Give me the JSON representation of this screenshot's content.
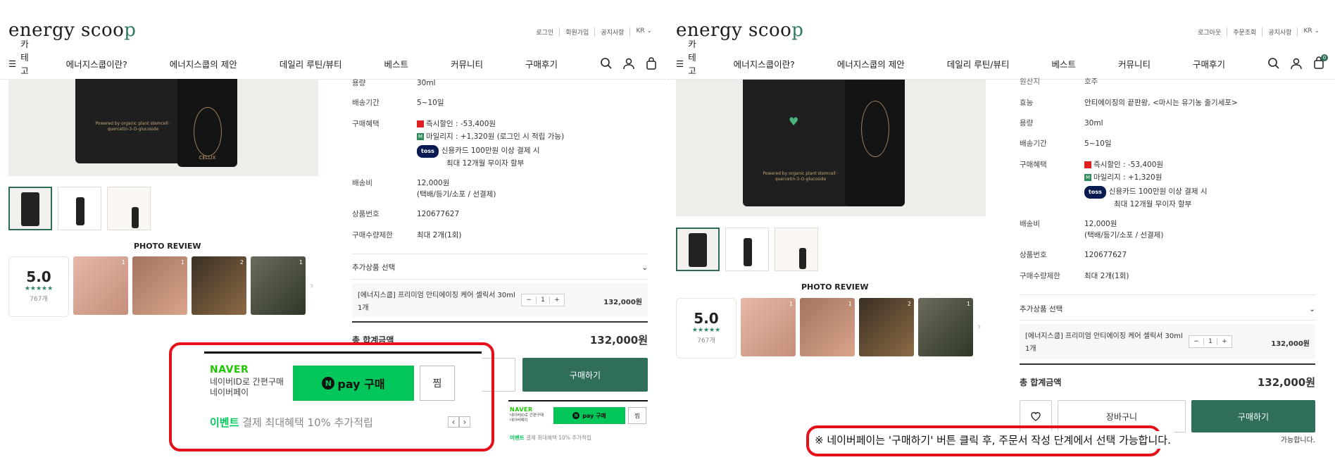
{
  "header": {
    "logo": "energy scoo",
    "logo_tail": "p",
    "left_util": [
      "로그인",
      "회원가입",
      "공지사항",
      "KR"
    ],
    "right_util": [
      "로그아웃",
      "주문조회",
      "공지사항",
      "KR"
    ],
    "category_label": "카테고리",
    "nav_items": [
      "에너지스쿱이란?",
      "에너지스쿱의 제안",
      "데일리 루틴/뷰티",
      "베스트",
      "커뮤니티",
      "구매후기"
    ],
    "cart_count": "0"
  },
  "product": {
    "bottle_text": "Powered by organic plant stemcell · quercetin-3-O-glucoside",
    "brand_on_bottle": "CELLIX",
    "photo_review_title": "PHOTO REVIEW",
    "rating": "5.0",
    "stars": "★★★★★",
    "review_count": "767개",
    "photo_badges": [
      "1",
      "1",
      "2",
      "1"
    ]
  },
  "info_left": {
    "capacity_label": "용량",
    "capacity": "30ml",
    "delivery_label": "배송기간",
    "delivery": "5~10일",
    "benefit_label": "구매혜택",
    "discount": "즉시할인 : -53,400원",
    "mileage": "마일리지 : +1,320원 (로그인 시 적립 가능)",
    "toss_label": "toss",
    "toss_line1": "신용카드 100만원 이상 결제 시",
    "toss_line2": "최대 12개월 무이자 할부",
    "shipping_label": "배송비",
    "shipping": "12,000원",
    "shipping_note": "(택배/등기/소포 / 선결제)",
    "product_no_label": "상품번호",
    "product_no": "120677627",
    "limit_label": "구매수량제한",
    "limit": "최대 2개(1회)"
  },
  "info_right": {
    "origin_label": "원산지",
    "origin": "호주",
    "effect_label": "효능",
    "effect": "안티에이징의 끝판왕, <마시는 유기농 줄기세포>",
    "mileage": "마일리지 : +1,320원"
  },
  "option": {
    "add_select_label": "추가상품 선택",
    "item_name": "[에너지스쿱] 프리미엄 안티에이징 케어 셀릭서 30ml",
    "item_qty_label": "1개",
    "qty": "1",
    "minus": "−",
    "plus": "+",
    "item_price": "132,000원"
  },
  "total": {
    "label": "총 합계금액",
    "amount": "132,000원"
  },
  "buttons": {
    "buy": "구매하기",
    "cart": "장바구니",
    "wish_icon": "heart-icon"
  },
  "naverpay": {
    "brand": "NAVER",
    "desc1": "네이버ID로 간편구매",
    "desc2": "네이버페이",
    "pay_label": "pay 구매",
    "n_letter": "N",
    "zzim": "찜",
    "event_label": "이벤트",
    "event_text": "결제 최대혜택 10% 추가적립",
    "prev": "‹",
    "next": "›"
  },
  "notice": {
    "text": "※ 네이버페이는 '구매하기' 버튼 클릭 후, 주문서 작성 단계에서 선택 가능합니다.",
    "tail": "가능합니다."
  },
  "colors": {
    "accent": "#2f6e5b",
    "naver_green": "#03c75a",
    "callout_red": "#e5101a"
  }
}
